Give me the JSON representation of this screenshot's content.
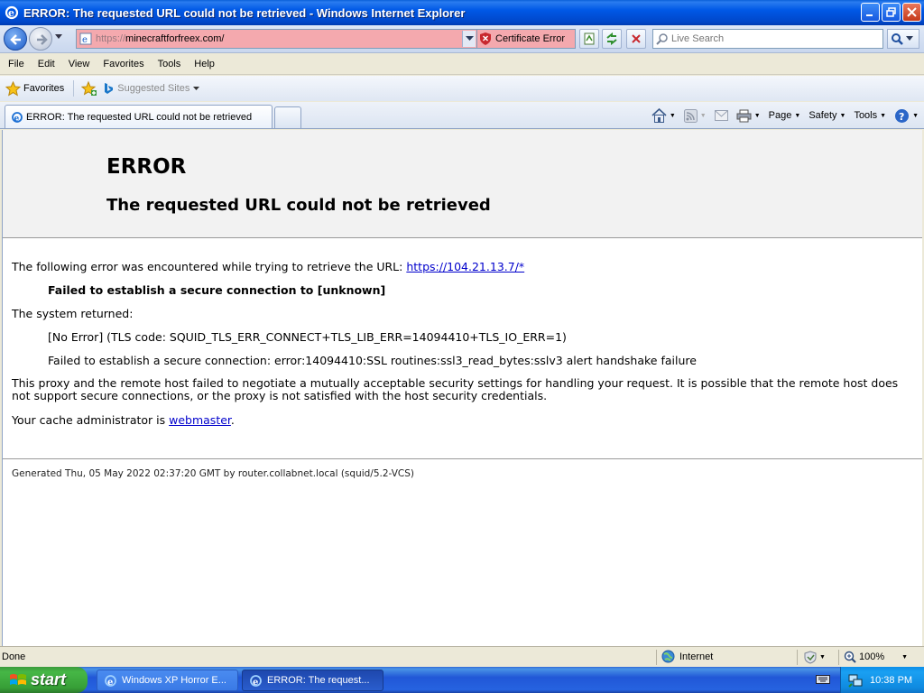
{
  "window": {
    "title": "ERROR: The requested URL could not be retrieved - Windows Internet Explorer"
  },
  "address_bar": {
    "protocol": "https://",
    "host": "minecraftforfreex.com/",
    "cert_error_label": "Certificate Error"
  },
  "search": {
    "placeholder": "Live Search"
  },
  "menu": [
    "File",
    "Edit",
    "View",
    "Favorites",
    "Tools",
    "Help"
  ],
  "favorites_bar": {
    "favorites_label": "Favorites",
    "suggested_sites_label": "Suggested Sites"
  },
  "tab": {
    "label": "ERROR: The requested URL could not be retrieved"
  },
  "command_bar": {
    "page": "Page",
    "safety": "Safety",
    "tools": "Tools"
  },
  "page": {
    "heading": "ERROR",
    "subheading": "The requested URL could not be retrieved",
    "intro_text": "The following error was encountered while trying to retrieve the URL: ",
    "intro_link": "https://104.21.13.7/*",
    "failure_bold": "Failed to establish a secure connection to [unknown]",
    "system_returned": "The system returned:",
    "tls_code": "[No Error] (TLS code: SQUID_TLS_ERR_CONNECT+TLS_LIB_ERR=14094410+TLS_IO_ERR=1)",
    "ssl_error": "Failed to establish a secure connection: error:14094410:SSL routines:ssl3_read_bytes:sslv3 alert handshake failure",
    "proxy_paragraph": "This proxy and the remote host failed to negotiate a mutually acceptable security settings for handling your request. It is possible that the remote host does not support secure connections, or the proxy is not satisfied with the host security credentials.",
    "admin_text": "Your cache administrator is ",
    "admin_link": "webmaster",
    "admin_suffix": ".",
    "generated": "Generated Thu, 05 May 2022 02:37:20 GMT by router.collabnet.local (squid/5.2-VCS)"
  },
  "status_bar": {
    "status": "Done",
    "zone": "Internet",
    "zoom": "100%"
  },
  "taskbar": {
    "start_label": "start",
    "tasks": [
      "Windows XP Horror E...",
      "ERROR: The request..."
    ],
    "clock": "10:38 PM"
  },
  "colors": {
    "titlebar": "#0058e6",
    "address_error_bg": "#f4a9ae",
    "link": "#0000cc",
    "taskbar": "#2157d7",
    "start_button": "#379f37"
  }
}
